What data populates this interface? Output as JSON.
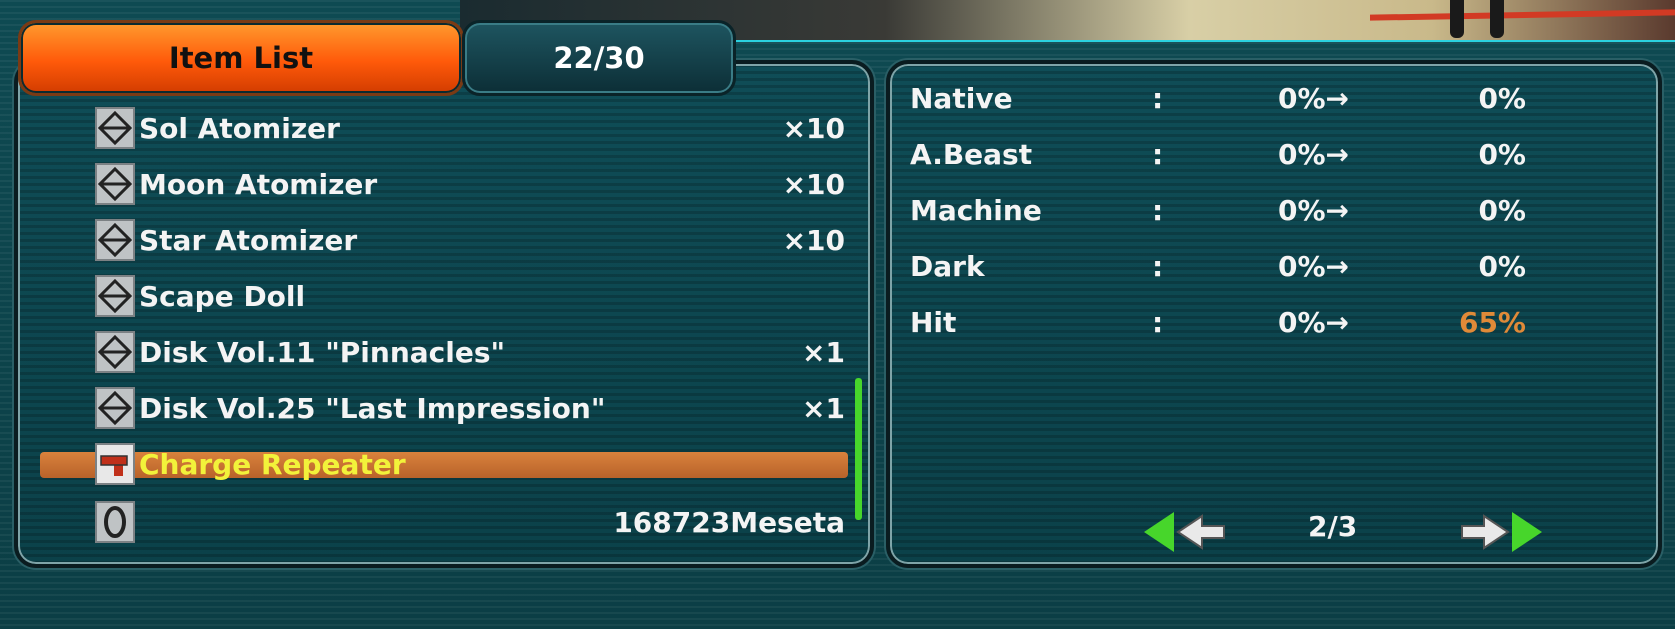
{
  "header": {
    "tab_label": "Item List",
    "count": "22/30"
  },
  "items": [
    {
      "name": "Sol Atomizer",
      "qty": "×10",
      "icon": "tool-icon"
    },
    {
      "name": "Moon Atomizer",
      "qty": "×10",
      "icon": "tool-icon"
    },
    {
      "name": "Star Atomizer",
      "qty": "×10",
      "icon": "tool-icon"
    },
    {
      "name": "Scape Doll",
      "qty": "",
      "icon": "tool-icon"
    },
    {
      "name": "Disk Vol.11 \"Pinnacles\"",
      "qty": "×1",
      "icon": "tool-icon"
    },
    {
      "name": "Disk Vol.25 \"Last Impression\"",
      "qty": "×1",
      "icon": "tool-icon"
    },
    {
      "name": "Charge Repeater",
      "qty": "",
      "icon": "gun-icon",
      "selected": true
    },
    {
      "name": "",
      "qty": "168723Meseta",
      "icon": "meseta-icon"
    }
  ],
  "stats": [
    {
      "label": "Native",
      "colon": ":",
      "from": "0%→",
      "to": "0%"
    },
    {
      "label": "A.Beast",
      "colon": ":",
      "from": "0%→",
      "to": "0%"
    },
    {
      "label": "Machine",
      "colon": ":",
      "from": "0%→",
      "to": "0%"
    },
    {
      "label": "Dark",
      "colon": ":",
      "from": "0%→",
      "to": "0%"
    },
    {
      "label": "Hit",
      "colon": ":",
      "from": "0%→",
      "to": "65%",
      "highlight": true
    }
  ],
  "pager": {
    "page": "2/3"
  },
  "colors": {
    "accent_orange": "#ff5a0a",
    "highlight_text": "#f2f23a",
    "stat_highlight": "#e08a38",
    "nav_green": "#47d62b"
  }
}
